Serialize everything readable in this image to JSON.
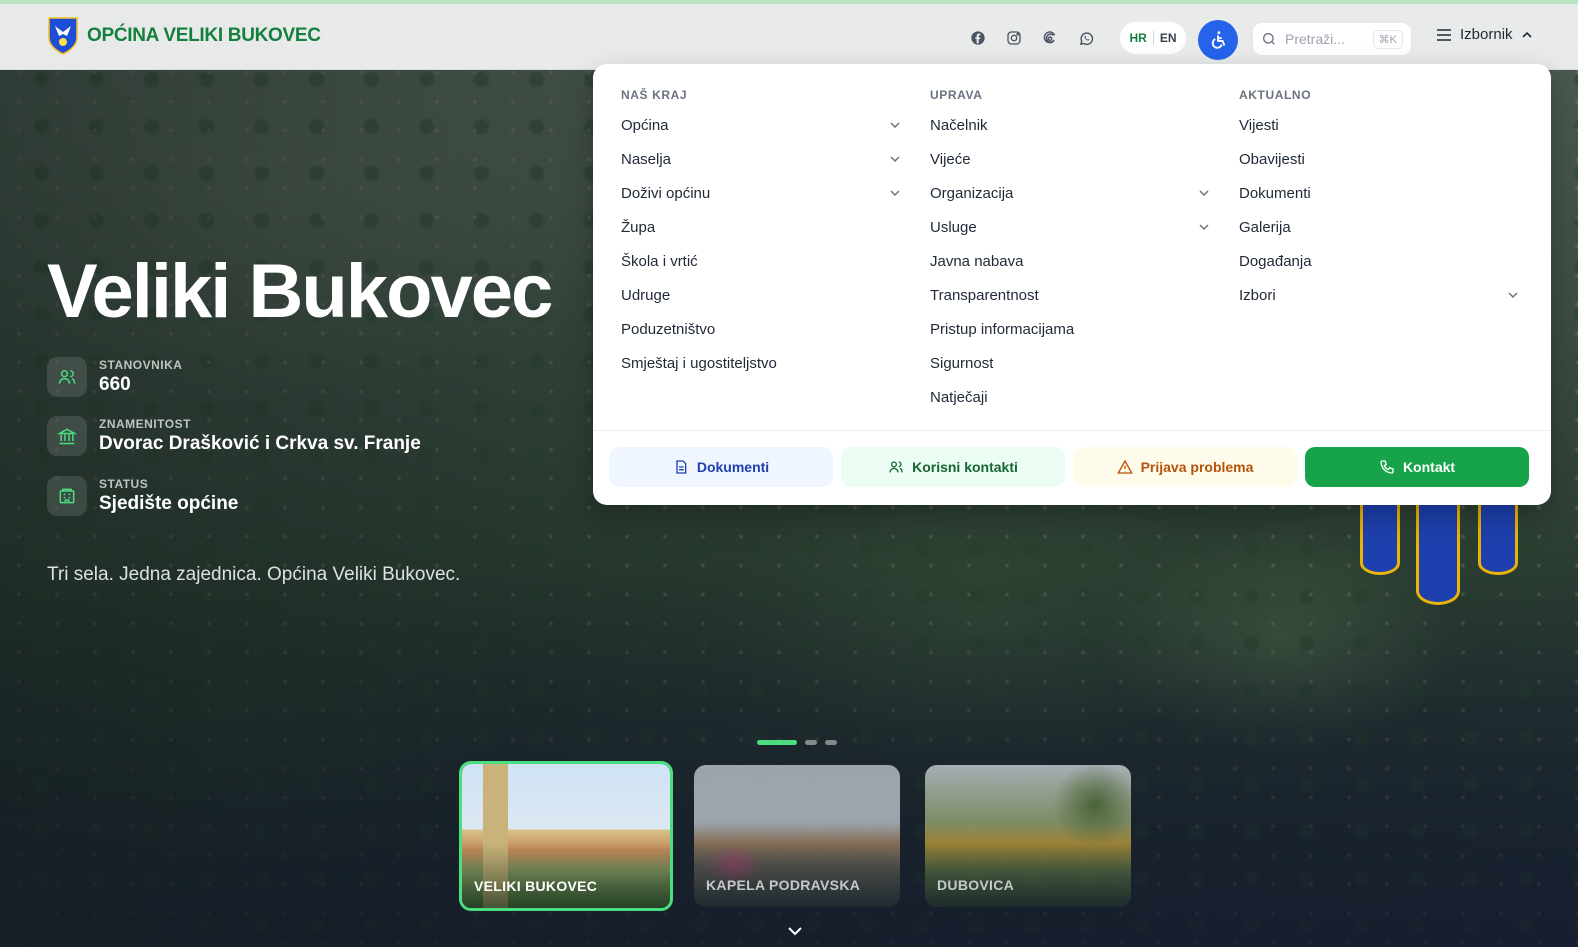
{
  "header": {
    "logo_text": "OPĆINA VELIKI BUKOVEC",
    "social_icons": [
      "facebook-icon",
      "instagram-icon",
      "threads-icon",
      "whatsapp-icon"
    ],
    "lang_active": "HR",
    "lang_other": "EN",
    "search_placeholder": "Pretraži...",
    "search_shortcut": "⌘K",
    "menu_label": "Izbornik"
  },
  "hero": {
    "title": "Veliki Bukovec",
    "stats": [
      {
        "label": "STANOVNIKA",
        "value": "660",
        "icon": "users-icon"
      },
      {
        "label": "ZNAMENITOST",
        "value": "Dvorac Drašković i Crkva sv. Franje",
        "icon": "landmark-icon"
      },
      {
        "label": "STATUS",
        "value": "Sjedište općine",
        "icon": "building-icon"
      }
    ],
    "tagline": "Tri sela. Jedna zajednica. Općina Veliki Bukovec."
  },
  "mega_menu": {
    "columns": [
      {
        "heading": "NAŠ KRAJ",
        "items": [
          {
            "label": "Općina",
            "expandable": true
          },
          {
            "label": "Naselja",
            "expandable": true
          },
          {
            "label": "Doživi općinu",
            "expandable": true
          },
          {
            "label": "Župa",
            "expandable": false
          },
          {
            "label": "Škola i vrtić",
            "expandable": false
          },
          {
            "label": "Udruge",
            "expandable": false
          },
          {
            "label": "Poduzetništvo",
            "expandable": false
          },
          {
            "label": "Smještaj i ugostiteljstvo",
            "expandable": false
          }
        ]
      },
      {
        "heading": "UPRAVA",
        "items": [
          {
            "label": "Načelnik",
            "expandable": false
          },
          {
            "label": "Vijeće",
            "expandable": false
          },
          {
            "label": "Organizacija",
            "expandable": true
          },
          {
            "label": "Usluge",
            "expandable": true
          },
          {
            "label": "Javna nabava",
            "expandable": false
          },
          {
            "label": "Transparentnost",
            "expandable": false
          },
          {
            "label": "Pristup informacijama",
            "expandable": false
          },
          {
            "label": "Sigurnost",
            "expandable": false
          },
          {
            "label": "Natječaji",
            "expandable": false
          }
        ]
      },
      {
        "heading": "AKTUALNO",
        "items": [
          {
            "label": "Vijesti",
            "expandable": false
          },
          {
            "label": "Obavijesti",
            "expandable": false
          },
          {
            "label": "Dokumenti",
            "expandable": false
          },
          {
            "label": "Galerija",
            "expandable": false
          },
          {
            "label": "Događanja",
            "expandable": false
          },
          {
            "label": "Izbori",
            "expandable": true
          }
        ]
      }
    ],
    "footer_buttons": {
      "documents": "Dokumenti",
      "contacts": "Korisni kontakti",
      "problem": "Prijava problema",
      "contact": "Kontakt"
    }
  },
  "carousel": {
    "active_index": 0,
    "dot_count": 3,
    "cards": [
      "VELIKI BUKOVEC",
      "KAPELA PODRAVSKA",
      "DUBOVICA"
    ]
  },
  "colors": {
    "brand_green": "#15803d",
    "accent_green": "#16a34a",
    "accessibility_blue": "#2563eb",
    "card_active_border": "#4ade80"
  }
}
